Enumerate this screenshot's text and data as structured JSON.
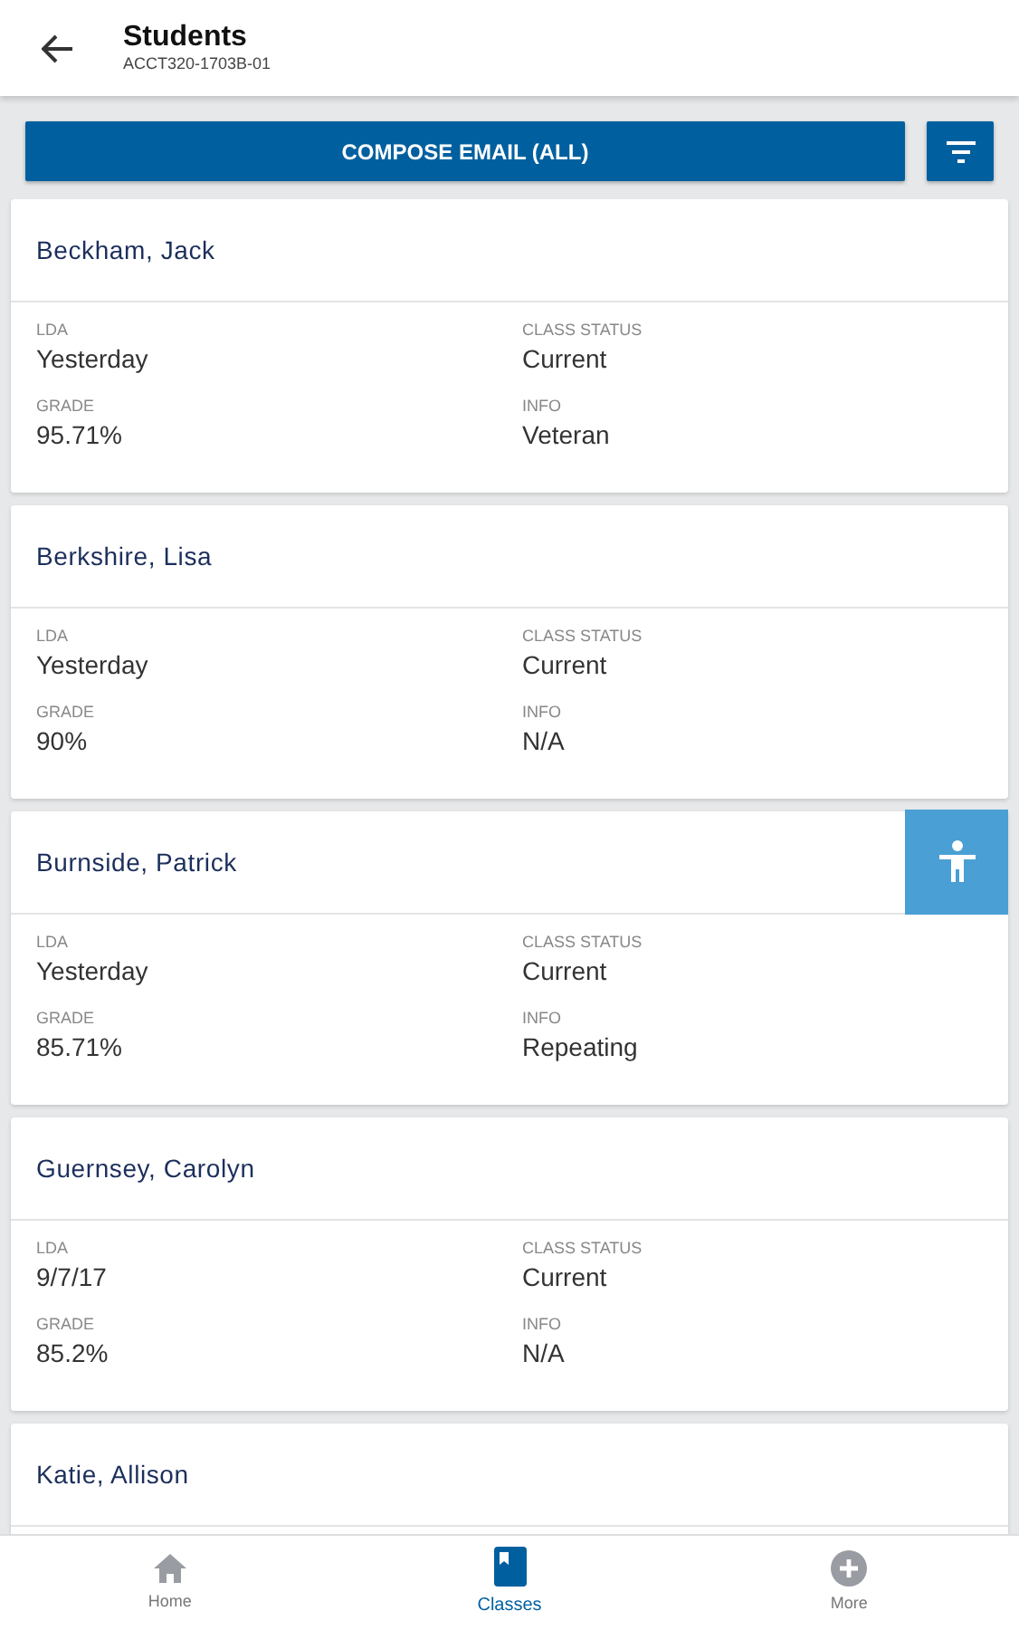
{
  "header": {
    "title": "Students",
    "subtitle": "ACCT320-1703B-01"
  },
  "compose_button": "COMPOSE EMAIL (ALL)",
  "students": [
    {
      "name": "Beckham, Jack",
      "fields": [
        {
          "label": "LDA",
          "value": "Yesterday"
        },
        {
          "label": "CLASS STATUS",
          "value": "Current"
        },
        {
          "label": "GRADE",
          "value": "95.71%"
        },
        {
          "label": "INFO",
          "value": "Veteran"
        }
      ]
    },
    {
      "name": "Berkshire, Lisa",
      "fields": [
        {
          "label": "LDA",
          "value": "Yesterday"
        },
        {
          "label": "CLASS STATUS",
          "value": "Current"
        },
        {
          "label": "GRADE",
          "value": "90%"
        },
        {
          "label": "INFO",
          "value": "N/A"
        }
      ]
    },
    {
      "name": "Burnside, Patrick",
      "fields": [
        {
          "label": "LDA",
          "value": "Yesterday"
        },
        {
          "label": "CLASS STATUS",
          "value": "Current"
        },
        {
          "label": "GRADE",
          "value": "85.71%"
        },
        {
          "label": "INFO",
          "value": "Repeating"
        }
      ]
    },
    {
      "name": "Guernsey, Carolyn",
      "fields": [
        {
          "label": "LDA",
          "value": "9/7/17"
        },
        {
          "label": "CLASS STATUS",
          "value": "Current"
        },
        {
          "label": "GRADE",
          "value": "85.2%"
        },
        {
          "label": "INFO",
          "value": "N/A"
        }
      ]
    },
    {
      "name": "Katie, Allison"
    }
  ],
  "nav": [
    {
      "kind": "home",
      "label": "Home",
      "selected": false
    },
    {
      "kind": "classes",
      "label": "Classes",
      "selected": true
    },
    {
      "kind": "more",
      "label": "More",
      "selected": false
    }
  ]
}
